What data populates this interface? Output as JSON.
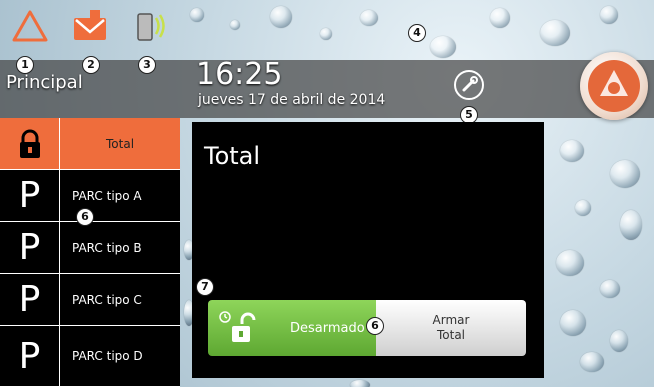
{
  "header": {
    "page_name": "Principal",
    "time": "16:25",
    "date": "jueves 17 de abril de 2014"
  },
  "icons": {
    "alarm": "alarm-triangle-icon",
    "message": "envelope-icon",
    "connection": "phone-signal-icon",
    "settings": "wrench-icon",
    "logo": "brand-logo"
  },
  "callouts": {
    "c1": "1",
    "c2": "2",
    "c3": "3",
    "c4": "4",
    "c5": "5",
    "c6a": "6",
    "c6b": "6",
    "c7": "7"
  },
  "list": {
    "items": [
      {
        "label": "Total",
        "icon": "lock-icon"
      },
      {
        "label": "PARC   tipo A",
        "icon": "P"
      },
      {
        "label": "PARC   tipo B",
        "icon": "P"
      },
      {
        "label": "PARC   tipo C",
        "icon": "P"
      },
      {
        "label": "PARC   tipo D",
        "icon": "P"
      }
    ]
  },
  "panel": {
    "title": "Total",
    "disarmed_label": "Desarmado",
    "arm_label_line1": "Armar",
    "arm_label_line2": "Total"
  },
  "colors": {
    "accent": "#ef6d3c",
    "disarmed_green": "#6cba3c",
    "panel_bg": "#000000"
  }
}
